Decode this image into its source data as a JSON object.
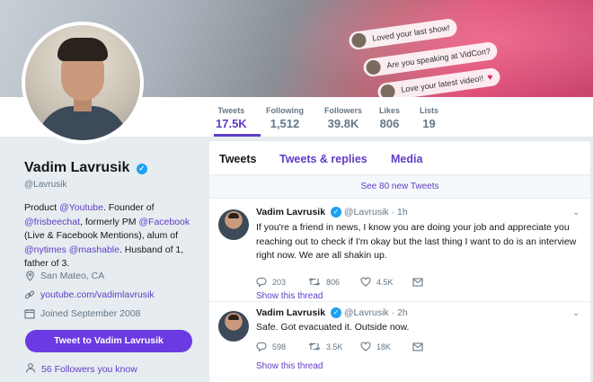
{
  "banner": {
    "bubbles": [
      {
        "text": "Loved your last show!",
        "heart": false
      },
      {
        "text": "Are you speaking at VidCon?",
        "heart": false
      },
      {
        "text": "Love your latest video!!",
        "heart": true
      }
    ]
  },
  "profile": {
    "name": "Vadim Lavrusik",
    "handle": "@Lavrusik",
    "bio": {
      "p1": "Product ",
      "l1": "@Youtube",
      "p2": ". Founder of ",
      "l2": "@frisbeechat",
      "p3": ", formerly PM ",
      "l3": "@Facebook",
      "p4": " (Live & Facebook Mentions), alum of ",
      "l4": "@nytimes",
      "p5": " ",
      "l5": "@mashable",
      "p6": ". Husband of 1, father of 3."
    },
    "location": "San Mateo, CA",
    "website": "youtube.com/vadimlavrusik",
    "joined": "Joined September 2008",
    "tweet_to_label": "Tweet to Vadim Lavrusik",
    "followers_you_know": "56 Followers you know"
  },
  "stats": [
    {
      "label": "Tweets",
      "value": "17.5K",
      "active": true
    },
    {
      "label": "Following",
      "value": "1,512",
      "active": false
    },
    {
      "label": "Followers",
      "value": "39.8K",
      "active": false
    },
    {
      "label": "Likes",
      "value": "806",
      "active": false
    },
    {
      "label": "Lists",
      "value": "19",
      "active": false
    }
  ],
  "timeline": {
    "tabs": [
      {
        "label": "Tweets",
        "active": true
      },
      {
        "label": "Tweets & replies",
        "active": false
      },
      {
        "label": "Media",
        "active": false
      }
    ],
    "new_tweets": "See 80 new Tweets",
    "tweets": [
      {
        "name": "Vadim Lavrusik",
        "handle": "@Lavrusik",
        "time": "· 1h",
        "text": "If you're a friend in news, I know you are doing your job and appreciate you reaching out to check if I'm okay but the last thing I want to do is an interview right now. We are all shakin up.",
        "replies": "203",
        "retweets": "806",
        "likes": "4.5K",
        "show_thread": "Show this thread"
      },
      {
        "name": "Vadim Lavrusik",
        "handle": "@Lavrusik",
        "time": "· 2h",
        "text": "Safe. Got evacuated it. Outside now.",
        "replies": "598",
        "retweets": "3.5K",
        "likes": "18K",
        "show_thread": "Show this thread"
      }
    ]
  },
  "colors": {
    "accent": "#5f3dc4",
    "button": "#6c3ae2",
    "verified": "#1da1f2",
    "muted": "#657786",
    "column_bg": "#e6ecf0"
  }
}
